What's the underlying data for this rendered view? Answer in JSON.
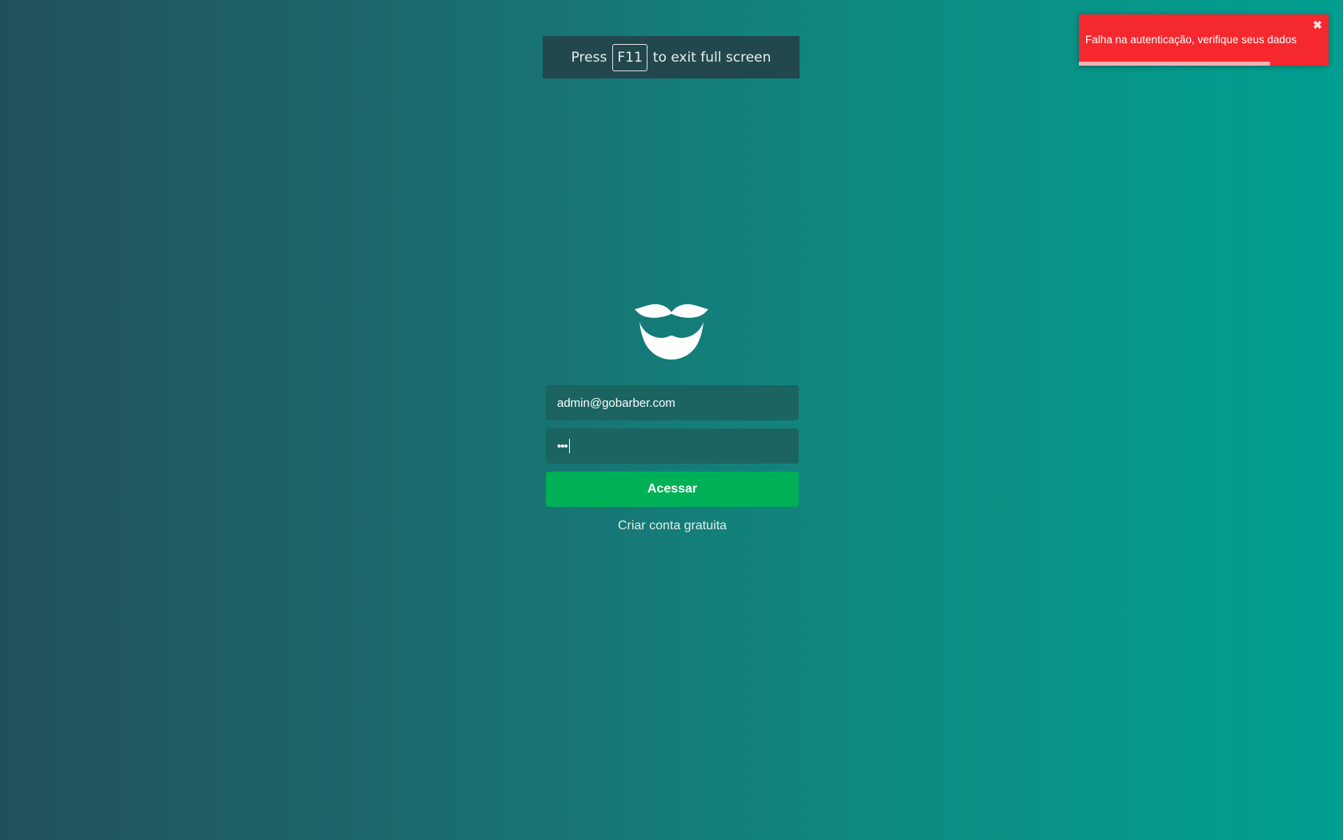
{
  "fullscreen_hint": {
    "prefix": "Press",
    "key": "F11",
    "suffix": "to exit full screen"
  },
  "toast": {
    "message": "Falha na autenticação, verifique seus dados",
    "close_icon": "close-icon",
    "progress_fraction": 0.765,
    "color": "#f5282e"
  },
  "login": {
    "logo_icon": "mustache-beard-icon",
    "email_value": "admin@gobarber.com",
    "password_masked": "•••",
    "submit_label": "Acessar",
    "signup_link": "Criar conta gratuita",
    "accent_color": "#00b056"
  }
}
